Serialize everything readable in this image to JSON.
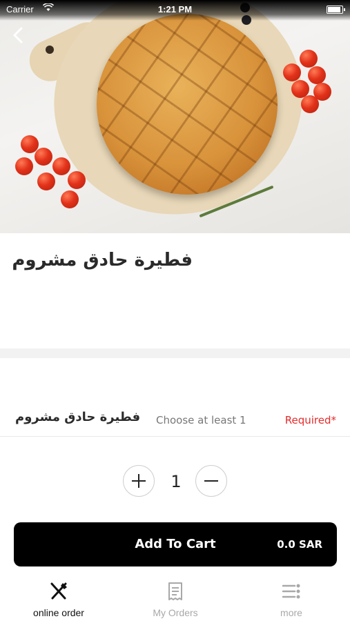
{
  "status_bar": {
    "carrier": "Carrier",
    "time": "1:21 PM"
  },
  "product": {
    "title": "فطيرة حادق مشروم"
  },
  "option_group": {
    "title": "فطيرة حادق مشروم",
    "hint": "Choose at least 1",
    "required_label": "Required*"
  },
  "quantity": {
    "value": "1"
  },
  "cart_button": {
    "label": "Add To Cart",
    "price": "0.0 SAR"
  },
  "tabs": [
    {
      "label": "online order",
      "icon": "fork-knife-icon",
      "active": true
    },
    {
      "label": "My Orders",
      "icon": "receipt-icon",
      "active": false
    },
    {
      "label": "more",
      "icon": "menu-dots-icon",
      "active": false
    }
  ],
  "colors": {
    "required": "#e52b2b",
    "button_bg": "#000000",
    "inactive_tab": "#a8a8a8"
  }
}
